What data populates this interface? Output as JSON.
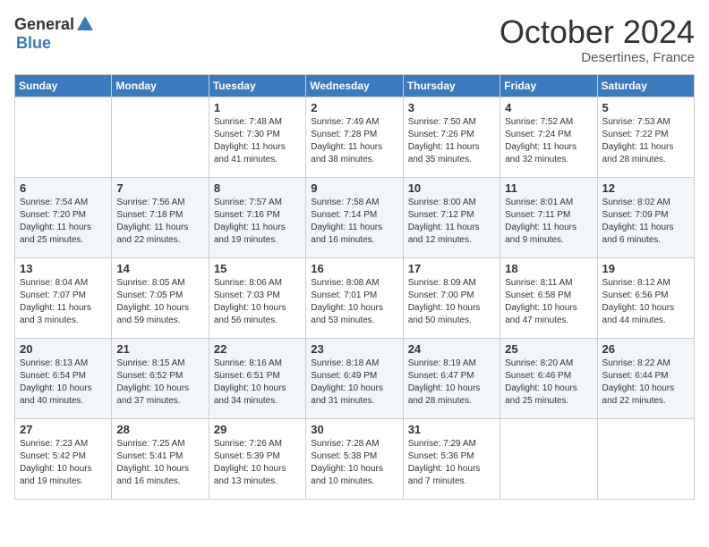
{
  "logo": {
    "general": "General",
    "blue": "Blue"
  },
  "header": {
    "month": "October 2024",
    "location": "Desertines, France"
  },
  "days_of_week": [
    "Sunday",
    "Monday",
    "Tuesday",
    "Wednesday",
    "Thursday",
    "Friday",
    "Saturday"
  ],
  "weeks": [
    [
      {
        "day": "",
        "sunrise": "",
        "sunset": "",
        "daylight": ""
      },
      {
        "day": "",
        "sunrise": "",
        "sunset": "",
        "daylight": ""
      },
      {
        "day": "1",
        "sunrise": "Sunrise: 7:48 AM",
        "sunset": "Sunset: 7:30 PM",
        "daylight": "Daylight: 11 hours and 41 minutes."
      },
      {
        "day": "2",
        "sunrise": "Sunrise: 7:49 AM",
        "sunset": "Sunset: 7:28 PM",
        "daylight": "Daylight: 11 hours and 38 minutes."
      },
      {
        "day": "3",
        "sunrise": "Sunrise: 7:50 AM",
        "sunset": "Sunset: 7:26 PM",
        "daylight": "Daylight: 11 hours and 35 minutes."
      },
      {
        "day": "4",
        "sunrise": "Sunrise: 7:52 AM",
        "sunset": "Sunset: 7:24 PM",
        "daylight": "Daylight: 11 hours and 32 minutes."
      },
      {
        "day": "5",
        "sunrise": "Sunrise: 7:53 AM",
        "sunset": "Sunset: 7:22 PM",
        "daylight": "Daylight: 11 hours and 28 minutes."
      }
    ],
    [
      {
        "day": "6",
        "sunrise": "Sunrise: 7:54 AM",
        "sunset": "Sunset: 7:20 PM",
        "daylight": "Daylight: 11 hours and 25 minutes."
      },
      {
        "day": "7",
        "sunrise": "Sunrise: 7:56 AM",
        "sunset": "Sunset: 7:18 PM",
        "daylight": "Daylight: 11 hours and 22 minutes."
      },
      {
        "day": "8",
        "sunrise": "Sunrise: 7:57 AM",
        "sunset": "Sunset: 7:16 PM",
        "daylight": "Daylight: 11 hours and 19 minutes."
      },
      {
        "day": "9",
        "sunrise": "Sunrise: 7:58 AM",
        "sunset": "Sunset: 7:14 PM",
        "daylight": "Daylight: 11 hours and 16 minutes."
      },
      {
        "day": "10",
        "sunrise": "Sunrise: 8:00 AM",
        "sunset": "Sunset: 7:12 PM",
        "daylight": "Daylight: 11 hours and 12 minutes."
      },
      {
        "day": "11",
        "sunrise": "Sunrise: 8:01 AM",
        "sunset": "Sunset: 7:11 PM",
        "daylight": "Daylight: 11 hours and 9 minutes."
      },
      {
        "day": "12",
        "sunrise": "Sunrise: 8:02 AM",
        "sunset": "Sunset: 7:09 PM",
        "daylight": "Daylight: 11 hours and 6 minutes."
      }
    ],
    [
      {
        "day": "13",
        "sunrise": "Sunrise: 8:04 AM",
        "sunset": "Sunset: 7:07 PM",
        "daylight": "Daylight: 11 hours and 3 minutes."
      },
      {
        "day": "14",
        "sunrise": "Sunrise: 8:05 AM",
        "sunset": "Sunset: 7:05 PM",
        "daylight": "Daylight: 10 hours and 59 minutes."
      },
      {
        "day": "15",
        "sunrise": "Sunrise: 8:06 AM",
        "sunset": "Sunset: 7:03 PM",
        "daylight": "Daylight: 10 hours and 56 minutes."
      },
      {
        "day": "16",
        "sunrise": "Sunrise: 8:08 AM",
        "sunset": "Sunset: 7:01 PM",
        "daylight": "Daylight: 10 hours and 53 minutes."
      },
      {
        "day": "17",
        "sunrise": "Sunrise: 8:09 AM",
        "sunset": "Sunset: 7:00 PM",
        "daylight": "Daylight: 10 hours and 50 minutes."
      },
      {
        "day": "18",
        "sunrise": "Sunrise: 8:11 AM",
        "sunset": "Sunset: 6:58 PM",
        "daylight": "Daylight: 10 hours and 47 minutes."
      },
      {
        "day": "19",
        "sunrise": "Sunrise: 8:12 AM",
        "sunset": "Sunset: 6:56 PM",
        "daylight": "Daylight: 10 hours and 44 minutes."
      }
    ],
    [
      {
        "day": "20",
        "sunrise": "Sunrise: 8:13 AM",
        "sunset": "Sunset: 6:54 PM",
        "daylight": "Daylight: 10 hours and 40 minutes."
      },
      {
        "day": "21",
        "sunrise": "Sunrise: 8:15 AM",
        "sunset": "Sunset: 6:52 PM",
        "daylight": "Daylight: 10 hours and 37 minutes."
      },
      {
        "day": "22",
        "sunrise": "Sunrise: 8:16 AM",
        "sunset": "Sunset: 6:51 PM",
        "daylight": "Daylight: 10 hours and 34 minutes."
      },
      {
        "day": "23",
        "sunrise": "Sunrise: 8:18 AM",
        "sunset": "Sunset: 6:49 PM",
        "daylight": "Daylight: 10 hours and 31 minutes."
      },
      {
        "day": "24",
        "sunrise": "Sunrise: 8:19 AM",
        "sunset": "Sunset: 6:47 PM",
        "daylight": "Daylight: 10 hours and 28 minutes."
      },
      {
        "day": "25",
        "sunrise": "Sunrise: 8:20 AM",
        "sunset": "Sunset: 6:46 PM",
        "daylight": "Daylight: 10 hours and 25 minutes."
      },
      {
        "day": "26",
        "sunrise": "Sunrise: 8:22 AM",
        "sunset": "Sunset: 6:44 PM",
        "daylight": "Daylight: 10 hours and 22 minutes."
      }
    ],
    [
      {
        "day": "27",
        "sunrise": "Sunrise: 7:23 AM",
        "sunset": "Sunset: 5:42 PM",
        "daylight": "Daylight: 10 hours and 19 minutes."
      },
      {
        "day": "28",
        "sunrise": "Sunrise: 7:25 AM",
        "sunset": "Sunset: 5:41 PM",
        "daylight": "Daylight: 10 hours and 16 minutes."
      },
      {
        "day": "29",
        "sunrise": "Sunrise: 7:26 AM",
        "sunset": "Sunset: 5:39 PM",
        "daylight": "Daylight: 10 hours and 13 minutes."
      },
      {
        "day": "30",
        "sunrise": "Sunrise: 7:28 AM",
        "sunset": "Sunset: 5:38 PM",
        "daylight": "Daylight: 10 hours and 10 minutes."
      },
      {
        "day": "31",
        "sunrise": "Sunrise: 7:29 AM",
        "sunset": "Sunset: 5:36 PM",
        "daylight": "Daylight: 10 hours and 7 minutes."
      },
      {
        "day": "",
        "sunrise": "",
        "sunset": "",
        "daylight": ""
      },
      {
        "day": "",
        "sunrise": "",
        "sunset": "",
        "daylight": ""
      }
    ]
  ]
}
